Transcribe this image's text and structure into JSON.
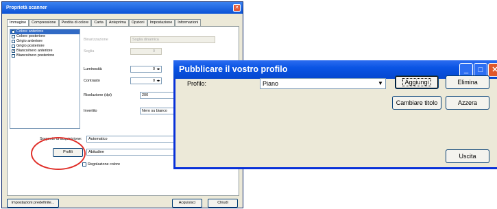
{
  "scanner_window": {
    "title": "Proprietà scanner",
    "tabs": [
      "Immagine",
      "Compressione",
      "Perdita di colore",
      "Carta",
      "Anteprima",
      "Opzioni",
      "Impostazione",
      "Informazioni"
    ],
    "image_list": [
      {
        "label": "Colore anteriore",
        "checked": true,
        "selected": true
      },
      {
        "label": "Colore posteriore",
        "checked": false,
        "selected": false
      },
      {
        "label": "Grigio anteriore",
        "checked": false,
        "selected": false
      },
      {
        "label": "Grigio posteriore",
        "checked": false,
        "selected": false
      },
      {
        "label": "Bianco/nero anteriore",
        "checked": true,
        "selected": false
      },
      {
        "label": "Bianco/nero posteriore",
        "checked": false,
        "selected": false
      }
    ],
    "binarization_label": "Binarizzazione",
    "binarization_value": "Soglia dinamica",
    "threshold_label": "Soglia",
    "threshold_value": "0",
    "brightness_label": "Luminosità",
    "brightness_value": "0",
    "contrast_label": "Contrasto",
    "contrast_value": "0",
    "resolution_label": "Risoluzione (dpi)",
    "resolution_value": "200",
    "invert_label": "Invertito",
    "invert_value": "Nero su bianco",
    "source_label": "Sorgente di acquisizione:",
    "source_value": "Automatico",
    "profiles_button": "Profili",
    "profile_value": "Abitudine",
    "color_adjust_label": "Regolazione colore",
    "defaults_button": "Impostazioni predefinite...",
    "acquire_button": "Acquisisci",
    "close_button": "Chiudi"
  },
  "profile_window": {
    "title": "Pubblicare il vostro profilo",
    "profile_label": "Profilo:",
    "profile_value": "Piano",
    "add_button": "Aggiungi",
    "delete_button": "Elimina",
    "rename_button": "Cambiare titolo",
    "reset_button": "Azzera",
    "exit_button": "Uscita"
  },
  "colors": {
    "titlebar_blue": "#0a54e4",
    "highlight_circle": "#e0302a",
    "window_bg": "#ece9d8"
  }
}
